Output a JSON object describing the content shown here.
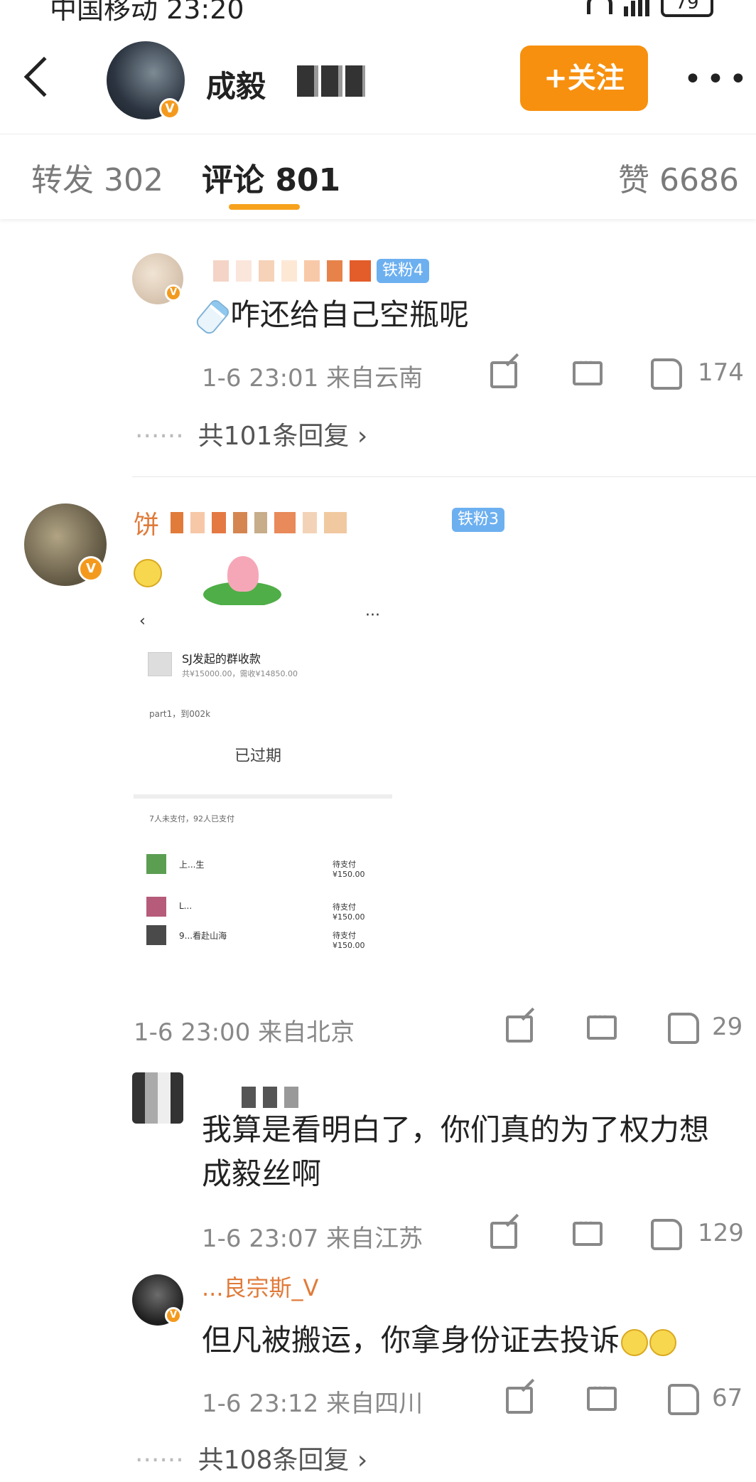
{
  "status_bar": {
    "carrier_time": "中国移动 23:20",
    "battery": "79"
  },
  "header": {
    "profile_name": "成毅",
    "follow_label": "+关注",
    "more_label": "•••"
  },
  "tabs": [
    {
      "label": "转发 302"
    },
    {
      "label": "评论 801"
    },
    {
      "label": "赞 6686"
    }
  ],
  "comments": [
    {
      "fan_badge": "铁粉4",
      "text": "咋还给自己空瓶呢",
      "time_location": "1-6 23:01  来自云南",
      "likes": "174",
      "replies": "共101条回复 ›"
    },
    {
      "username_prefix": "饼",
      "fan_badge": "铁粉3",
      "time_location": "1-6 23:00  来自北京",
      "likes": "29",
      "image": {
        "back": "‹",
        "more": "···",
        "title": "SJ发起的群收款",
        "amount": "共¥15000.00，需收¥14850.00",
        "note": "part1，到002k",
        "expired": "已过期",
        "summary": "7人未支付，92人已支付",
        "rows": [
          {
            "name": "上...生",
            "status": "待支付¥150.00"
          },
          {
            "name": "L...",
            "status": "待支付¥150.00"
          },
          {
            "name": "9...看赴山海",
            "status": "待支付¥150.00"
          }
        ]
      }
    },
    {
      "text": "我算是看明白了，你们真的为了权力想成毅丝啊",
      "time_location": "1-6 23:07  来自江苏",
      "likes": "129"
    },
    {
      "username": "...良宗斯_V",
      "text": "但凡被搬运，你拿身份证去投诉",
      "time_location": "1-6 23:12  来自四川",
      "likes": "67",
      "replies": "共108条回复 ›"
    }
  ],
  "colors": {
    "accent_orange": "#f7900f",
    "tab_underline": "#f7a21d",
    "fan_badge_blue": "#6db0f0",
    "meta_gray": "#888888"
  }
}
